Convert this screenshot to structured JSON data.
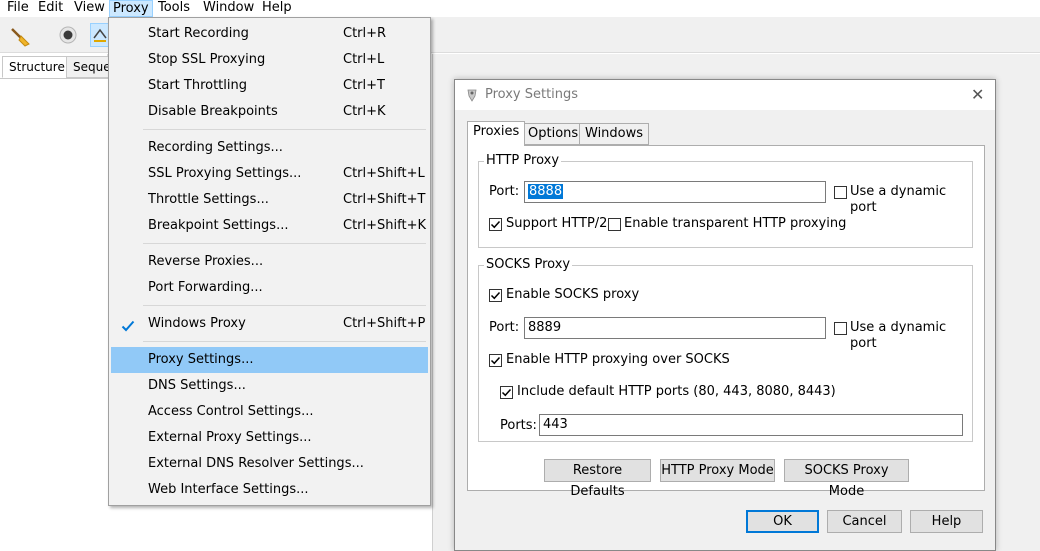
{
  "menubar": {
    "items": [
      {
        "label": "File"
      },
      {
        "label": "Edit"
      },
      {
        "label": "View"
      },
      {
        "label": "Proxy"
      },
      {
        "label": "Tools"
      },
      {
        "label": "Window"
      },
      {
        "label": "Help"
      }
    ]
  },
  "left_tabs": [
    "Structure",
    "Seque"
  ],
  "proxy_menu": {
    "items": [
      {
        "label": "Start Recording",
        "shortcut": "Ctrl+R"
      },
      {
        "label": "Stop SSL Proxying",
        "shortcut": "Ctrl+L"
      },
      {
        "label": "Start Throttling",
        "shortcut": "Ctrl+T"
      },
      {
        "label": "Disable Breakpoints",
        "shortcut": "Ctrl+K"
      },
      {
        "label": "Recording Settings...",
        "shortcut": ""
      },
      {
        "label": "SSL Proxying Settings...",
        "shortcut": "Ctrl+Shift+L"
      },
      {
        "label": "Throttle Settings...",
        "shortcut": "Ctrl+Shift+T"
      },
      {
        "label": "Breakpoint Settings...",
        "shortcut": "Ctrl+Shift+K"
      },
      {
        "label": "Reverse Proxies...",
        "shortcut": ""
      },
      {
        "label": "Port Forwarding...",
        "shortcut": ""
      },
      {
        "label": "Windows Proxy",
        "shortcut": "Ctrl+Shift+P",
        "checked": true
      },
      {
        "label": "Proxy Settings...",
        "shortcut": "",
        "highlighted": true
      },
      {
        "label": "DNS Settings...",
        "shortcut": ""
      },
      {
        "label": "Access Control Settings...",
        "shortcut": ""
      },
      {
        "label": "External Proxy Settings...",
        "shortcut": ""
      },
      {
        "label": "External DNS Resolver Settings...",
        "shortcut": ""
      },
      {
        "label": "Web Interface Settings...",
        "shortcut": ""
      }
    ]
  },
  "dialog": {
    "title": "Proxy Settings",
    "close_glyph": "✕",
    "tabs": [
      "Proxies",
      "Options",
      "Windows"
    ],
    "http_proxy": {
      "group_label": "HTTP Proxy",
      "port_label": "Port:",
      "port_value": "8888",
      "dynamic_port_label": "Use a dynamic port",
      "dynamic_port_checked": false,
      "http2_label": "Support HTTP/2",
      "http2_checked": true,
      "transparent_label": "Enable transparent HTTP proxying",
      "transparent_checked": false
    },
    "socks_proxy": {
      "group_label": "SOCKS Proxy",
      "enable_label": "Enable SOCKS proxy",
      "enable_checked": true,
      "port_label": "Port:",
      "port_value": "8889",
      "dynamic_port_label": "Use a dynamic port",
      "dynamic_port_checked": false,
      "http_over_socks_label": "Enable HTTP proxying over SOCKS",
      "http_over_socks_checked": true,
      "include_default_label": "Include default HTTP ports (80, 443, 8080, 8443)",
      "include_default_checked": true,
      "ports_label": "Ports:",
      "ports_value": "443"
    },
    "buttons": {
      "restore": "Restore Defaults",
      "http_mode": "HTTP Proxy Mode",
      "socks_mode": "SOCKS Proxy Mode",
      "ok": "OK",
      "cancel": "Cancel",
      "help": "Help"
    }
  },
  "colors": {
    "menu_highlight": "#91c9f7",
    "accent": "#0078d7",
    "check": "#0078d7"
  }
}
